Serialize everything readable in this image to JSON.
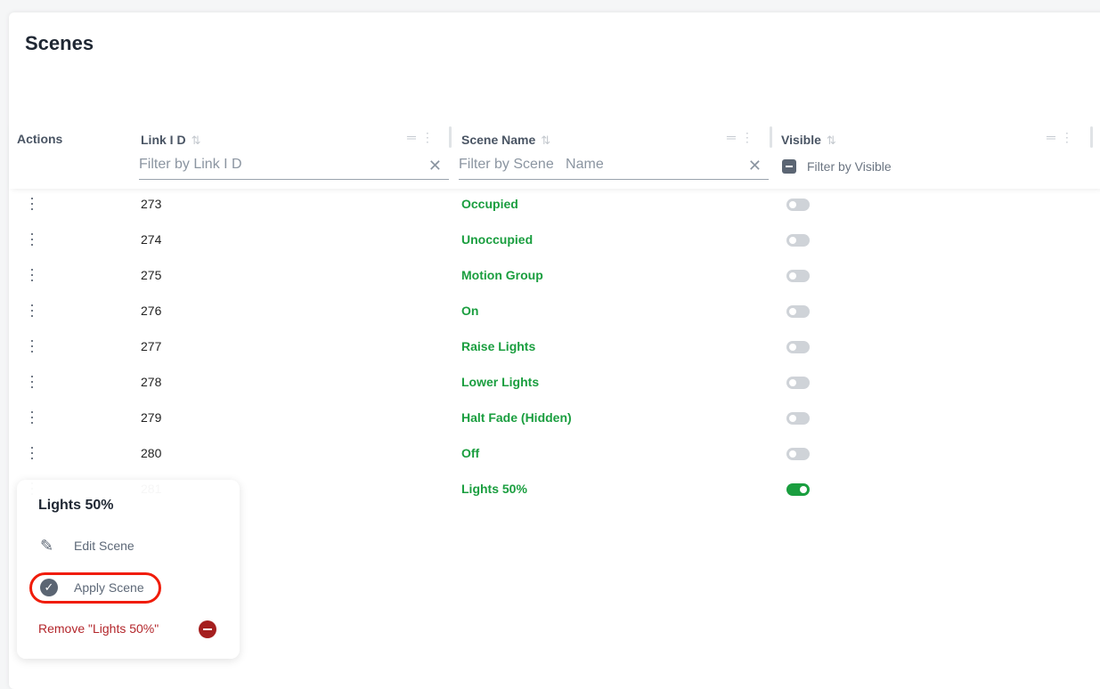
{
  "page": {
    "title": "Scenes"
  },
  "table": {
    "columns": [
      {
        "label": "Actions"
      },
      {
        "label": "Link I D",
        "filter_placeholder": "Filter by Link I D"
      },
      {
        "label": "Scene Name",
        "filter_placeholder": "Filter by Scene   Name"
      },
      {
        "label": "Visible",
        "filter_placeholder": "Filter by Visible"
      }
    ],
    "rows": [
      {
        "link_id": "273",
        "scene_name": "Occupied",
        "visible": false
      },
      {
        "link_id": "274",
        "scene_name": "Unoccupied",
        "visible": false
      },
      {
        "link_id": "275",
        "scene_name": "Motion Group",
        "visible": false
      },
      {
        "link_id": "276",
        "scene_name": "On",
        "visible": false
      },
      {
        "link_id": "277",
        "scene_name": "Raise Lights",
        "visible": false
      },
      {
        "link_id": "278",
        "scene_name": "Lower Lights",
        "visible": false
      },
      {
        "link_id": "279",
        "scene_name": "Halt Fade (Hidden)",
        "visible": false
      },
      {
        "link_id": "280",
        "scene_name": "Off",
        "visible": false
      },
      {
        "link_id": "281",
        "scene_name": "Lights 50%",
        "visible": true
      }
    ]
  },
  "popup": {
    "title": "Lights 50%",
    "edit_label": "Edit Scene",
    "apply_label": "Apply Scene",
    "remove_label": "Remove \"Lights 50%\""
  },
  "colors": {
    "accent_green": "#1a9e3f",
    "danger": "#b3262b",
    "highlight": "#f01c0a"
  }
}
